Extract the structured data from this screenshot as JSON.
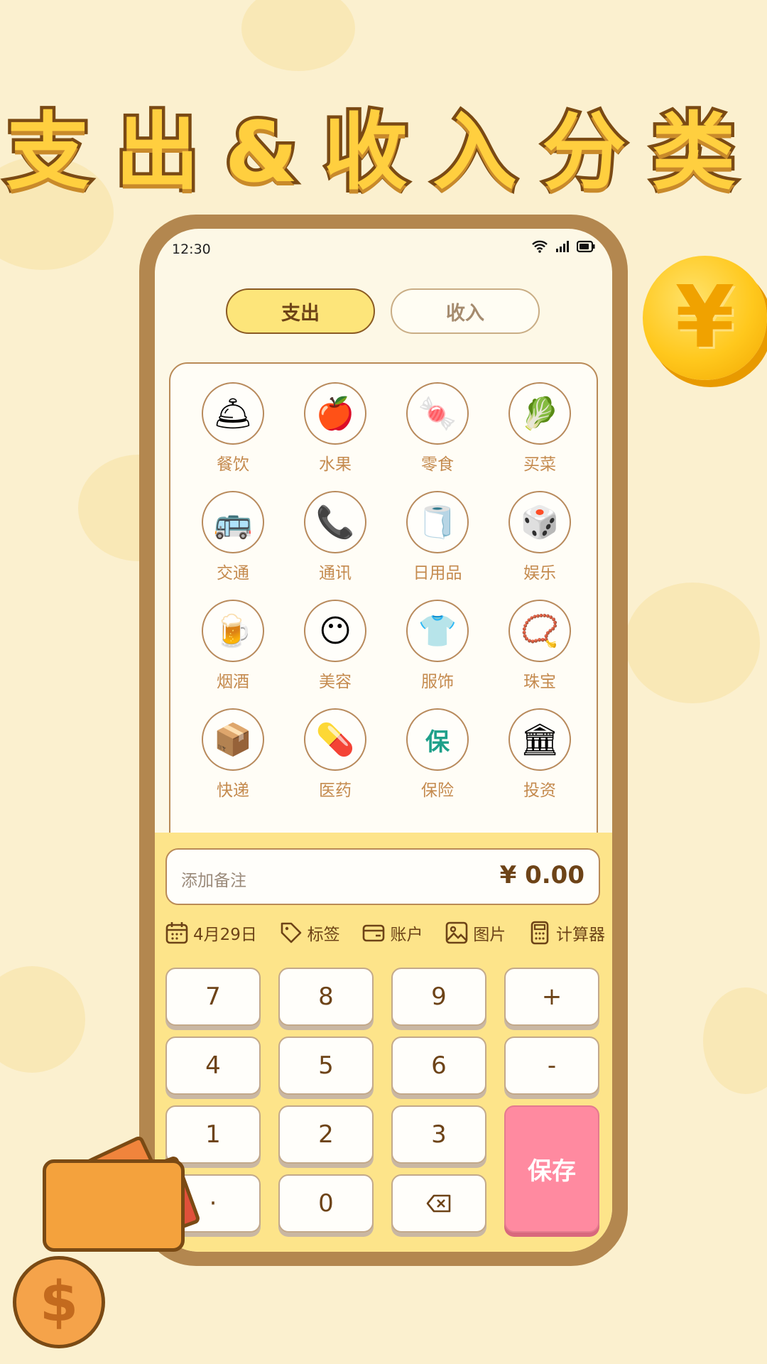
{
  "headline": "支出&收入分类",
  "coin_symbol": "¥",
  "status_bar": {
    "time": "12:30"
  },
  "tabs": [
    {
      "label": "支出",
      "active": true
    },
    {
      "label": "收入",
      "active": false
    }
  ],
  "categories": [
    {
      "label": "餐饮",
      "icon": "food-dome-icon",
      "glyph": "🛎"
    },
    {
      "label": "水果",
      "icon": "apple-icon",
      "glyph": "🍎"
    },
    {
      "label": "零食",
      "icon": "snack-icon",
      "glyph": "🍬"
    },
    {
      "label": "买菜",
      "icon": "cabbage-icon",
      "glyph": "🥬"
    },
    {
      "label": "交通",
      "icon": "bus-icon",
      "glyph": "🚌"
    },
    {
      "label": "通讯",
      "icon": "phone-icon",
      "glyph": "📞"
    },
    {
      "label": "日用品",
      "icon": "tissue-roll-icon",
      "glyph": "🧻"
    },
    {
      "label": "娱乐",
      "icon": "entertainment-icon",
      "glyph": "🎲"
    },
    {
      "label": "烟酒",
      "icon": "beer-icon",
      "glyph": "🍺"
    },
    {
      "label": "美容",
      "icon": "face-mask-icon",
      "glyph": "😶"
    },
    {
      "label": "服饰",
      "icon": "tshirt-icon",
      "glyph": "👕"
    },
    {
      "label": "珠宝",
      "icon": "necklace-icon",
      "glyph": "📿"
    },
    {
      "label": "快递",
      "icon": "package-icon",
      "glyph": "📦"
    },
    {
      "label": "医药",
      "icon": "pill-icon",
      "glyph": "💊"
    },
    {
      "label": "保险",
      "icon": "insurance-shield-icon",
      "glyph": "保"
    },
    {
      "label": "投资",
      "icon": "bank-icon",
      "glyph": "🏛"
    }
  ],
  "note": {
    "placeholder": "添加备注",
    "amount": "¥ 0.00"
  },
  "toolbar": [
    {
      "label": "4月29日",
      "icon": "calendar-icon"
    },
    {
      "label": "标签",
      "icon": "tag-icon"
    },
    {
      "label": "账户",
      "icon": "wallet-card-icon"
    },
    {
      "label": "图片",
      "icon": "image-icon"
    },
    {
      "label": "计算器",
      "icon": "calculator-icon"
    }
  ],
  "keypad": {
    "k7": "7",
    "k8": "8",
    "k9": "9",
    "plus": "+",
    "k4": "4",
    "k5": "5",
    "k6": "6",
    "minus": "-",
    "k1": "1",
    "k2": "2",
    "k3": "3",
    "dot": "·",
    "k0": "0",
    "save": "保存"
  },
  "decor_dollar": "$",
  "colors": {
    "accent": "#fde57a",
    "save": "#ff8aa0",
    "brown": "#6d4317",
    "background": "#fbf0cf"
  }
}
